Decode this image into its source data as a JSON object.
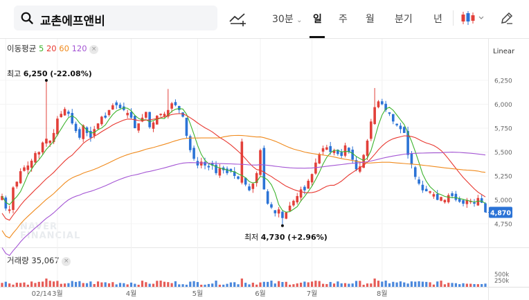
{
  "search": {
    "query": "교촌에프앤비",
    "icon": "search-icon"
  },
  "toolbar": {
    "draw_tool_icon": "trend-draw-icon",
    "periods": [
      "30분",
      "일",
      "주",
      "월",
      "분기",
      "년"
    ],
    "active_period": "일",
    "candle_type_icon": "candlestick-icon",
    "edit_icon": "pencil-icon"
  },
  "moving_average": {
    "label": "이동평균",
    "periods": [
      {
        "value": "5",
        "color": "#3cb32c"
      },
      {
        "value": "20",
        "color": "#e8372f"
      },
      {
        "value": "60",
        "color": "#f08a1c"
      },
      {
        "value": "120",
        "color": "#a455d4"
      }
    ]
  },
  "scale_mode": "Linear",
  "current_price": "4,870",
  "volume": {
    "label": "거래량",
    "value": "35,067",
    "axis_ticks": [
      "500k",
      "250k"
    ]
  },
  "watermark": [
    "NAVER",
    "FINANCIAL"
  ],
  "colors": {
    "up": "#e2403a",
    "down": "#2b73d6"
  },
  "chart_data": {
    "type": "candlestick",
    "y_axis": {
      "scale": "linear",
      "ticks": [
        "6,250",
        "6,000",
        "5,750",
        "5,500",
        "5,250",
        "5,000",
        "4,750"
      ]
    },
    "x_axis": {
      "ticks": [
        "02/14",
        "3월",
        "4월",
        "5월",
        "6월",
        "7월",
        "8월"
      ]
    },
    "annotations": {
      "high": {
        "label": "최고",
        "value": "6,250",
        "change": "(-22.08%)"
      },
      "low": {
        "label": "최저",
        "value": "4,730",
        "change": "(+2.96%)"
      }
    },
    "closes": [
      5040,
      4910,
      4900,
      5130,
      5190,
      5300,
      5340,
      5360,
      5410,
      5490,
      5500,
      5600,
      5640,
      5620,
      5700,
      5850,
      5900,
      5950,
      5900,
      5800,
      5720,
      5650,
      5780,
      5700,
      5650,
      5740,
      5800,
      5870,
      5860,
      5940,
      5990,
      5990,
      5960,
      5940,
      5910,
      5860,
      5750,
      5800,
      5860,
      5920,
      5760,
      5810,
      5880,
      5900,
      5900,
      5940,
      6010,
      5990,
      5940,
      5870,
      5670,
      5520,
      5430,
      5360,
      5400,
      5360,
      5340,
      5360,
      5280,
      5330,
      5310,
      5280,
      5300,
      5250,
      5220,
      5230,
      5160,
      5100,
      5170,
      5280,
      5520,
      5110,
      4960,
      4920,
      4860,
      4900,
      4810,
      4870,
      4940,
      4990,
      5040,
      5110,
      5100,
      5200,
      5270,
      5390,
      5480,
      5540,
      5550,
      5500,
      5520,
      5480,
      5460,
      5570,
      5500,
      5420,
      5320,
      5350,
      5470,
      5620,
      5820,
      5970,
      6030,
      6000,
      5940,
      5900,
      5820,
      5780,
      5740,
      5700,
      5470,
      5370,
      5240,
      5170,
      5100,
      5090,
      5090,
      5060,
      5000,
      5030,
      5000,
      5050,
      5040,
      5000,
      4980,
      4960,
      5000,
      4990,
      4960,
      5020,
      4970,
      4870
    ]
  }
}
